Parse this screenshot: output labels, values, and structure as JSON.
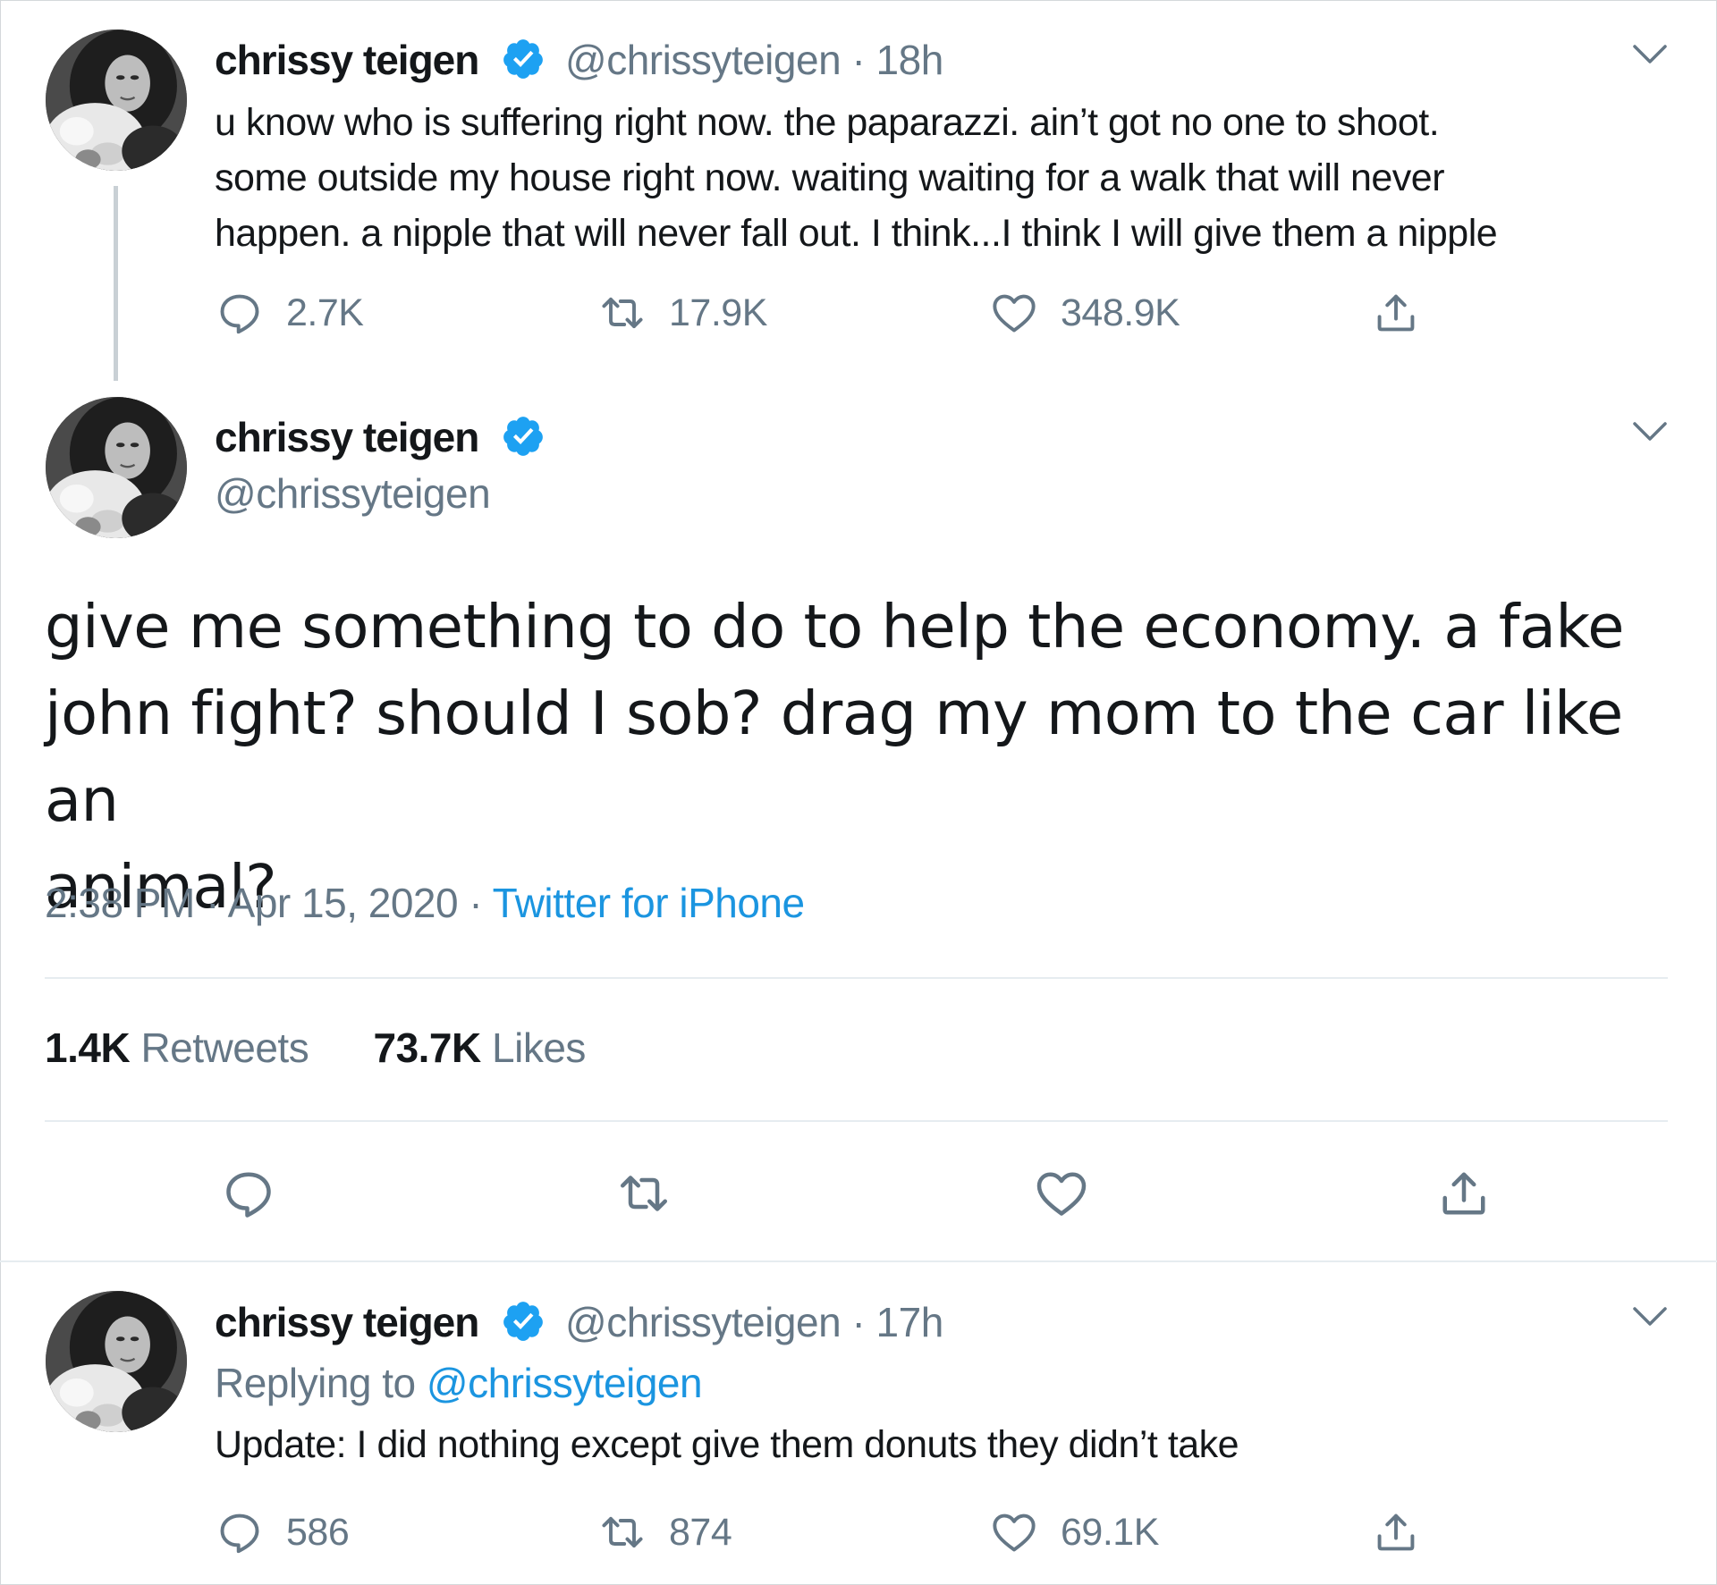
{
  "thread": {
    "tweets": [
      {
        "name": "chrissy teigen",
        "handle": "@chrissyteigen",
        "time": "18h",
        "separator": "·",
        "text_lines": [
          "u know who is suffering right now. the paparazzi. ain’t got no one to shoot.",
          "some outside my house right now. waiting waiting for a walk that will never",
          "happen. a nipple that will never fall out. I think...I think I will give them a nipple"
        ],
        "replies": "2.7K",
        "retweets": "17.9K",
        "likes": "348.9K"
      }
    ],
    "main": {
      "name": "chrissy teigen",
      "handle": "@chrissyteigen",
      "text_lines": [
        "give me something to do to help the economy. a fake",
        "john fight? should I sob? drag my mom to the car like an",
        "animal?"
      ],
      "time": "2:38 PM",
      "date": "Apr 15, 2020",
      "separator": "·",
      "source": "Twitter for iPhone",
      "retweets_count": "1.4K",
      "retweets_label": "Retweets",
      "likes_count": "73.7K",
      "likes_label": "Likes"
    },
    "reply": {
      "name": "chrissy teigen",
      "handle": "@chrissyteigen",
      "time": "17h",
      "separator": "·",
      "replying_prefix": "Replying to",
      "replying_handle": "@chrissyteigen",
      "text": "Update: I did nothing except give them donuts they didn’t take",
      "replies": "586",
      "retweets": "874",
      "likes": "69.1K"
    }
  },
  "icons": {
    "verified": "verified-badge-icon",
    "chevron": "chevron-down-icon",
    "reply": "reply-icon",
    "retweet": "retweet-icon",
    "like": "heart-icon",
    "share": "share-icon"
  },
  "colors": {
    "text": "#14171a",
    "secondary": "#657786",
    "link": "#1b95e0",
    "verified": "#1da1f2",
    "divider": "#e6ecf0"
  }
}
